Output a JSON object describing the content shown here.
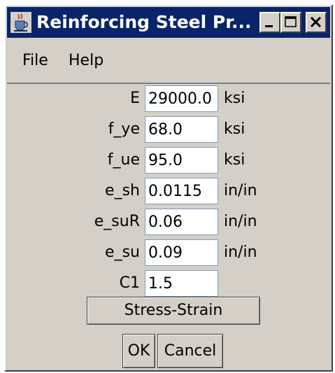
{
  "window": {
    "title": "Reinforcing Steel Pr...",
    "app_icon": "java-coffee-cup-icon",
    "controls": {
      "minimize_icon": "minimize-icon",
      "maximize_icon": "maximize-icon",
      "close_icon": "close-icon"
    }
  },
  "menu": {
    "items": [
      {
        "label": "File"
      },
      {
        "label": "Help"
      }
    ]
  },
  "form": {
    "rows": [
      {
        "label": "E",
        "value": "29000.0",
        "unit": "ksi"
      },
      {
        "label": "f_ye",
        "value": "68.0",
        "unit": "ksi"
      },
      {
        "label": "f_ue",
        "value": "95.0",
        "unit": "ksi"
      },
      {
        "label": "e_sh",
        "value": "0.0115",
        "unit": "in/in"
      },
      {
        "label": "e_suR",
        "value": "0.06",
        "unit": "in/in"
      },
      {
        "label": "e_su",
        "value": "0.09",
        "unit": "in/in"
      },
      {
        "label": "C1",
        "value": "1.5",
        "unit": ""
      }
    ]
  },
  "buttons": {
    "stress_strain": "Stress-Strain",
    "ok": "OK",
    "cancel": "Cancel"
  },
  "colors": {
    "titlebar": "#0a246a",
    "face": "#d4d0c8"
  }
}
